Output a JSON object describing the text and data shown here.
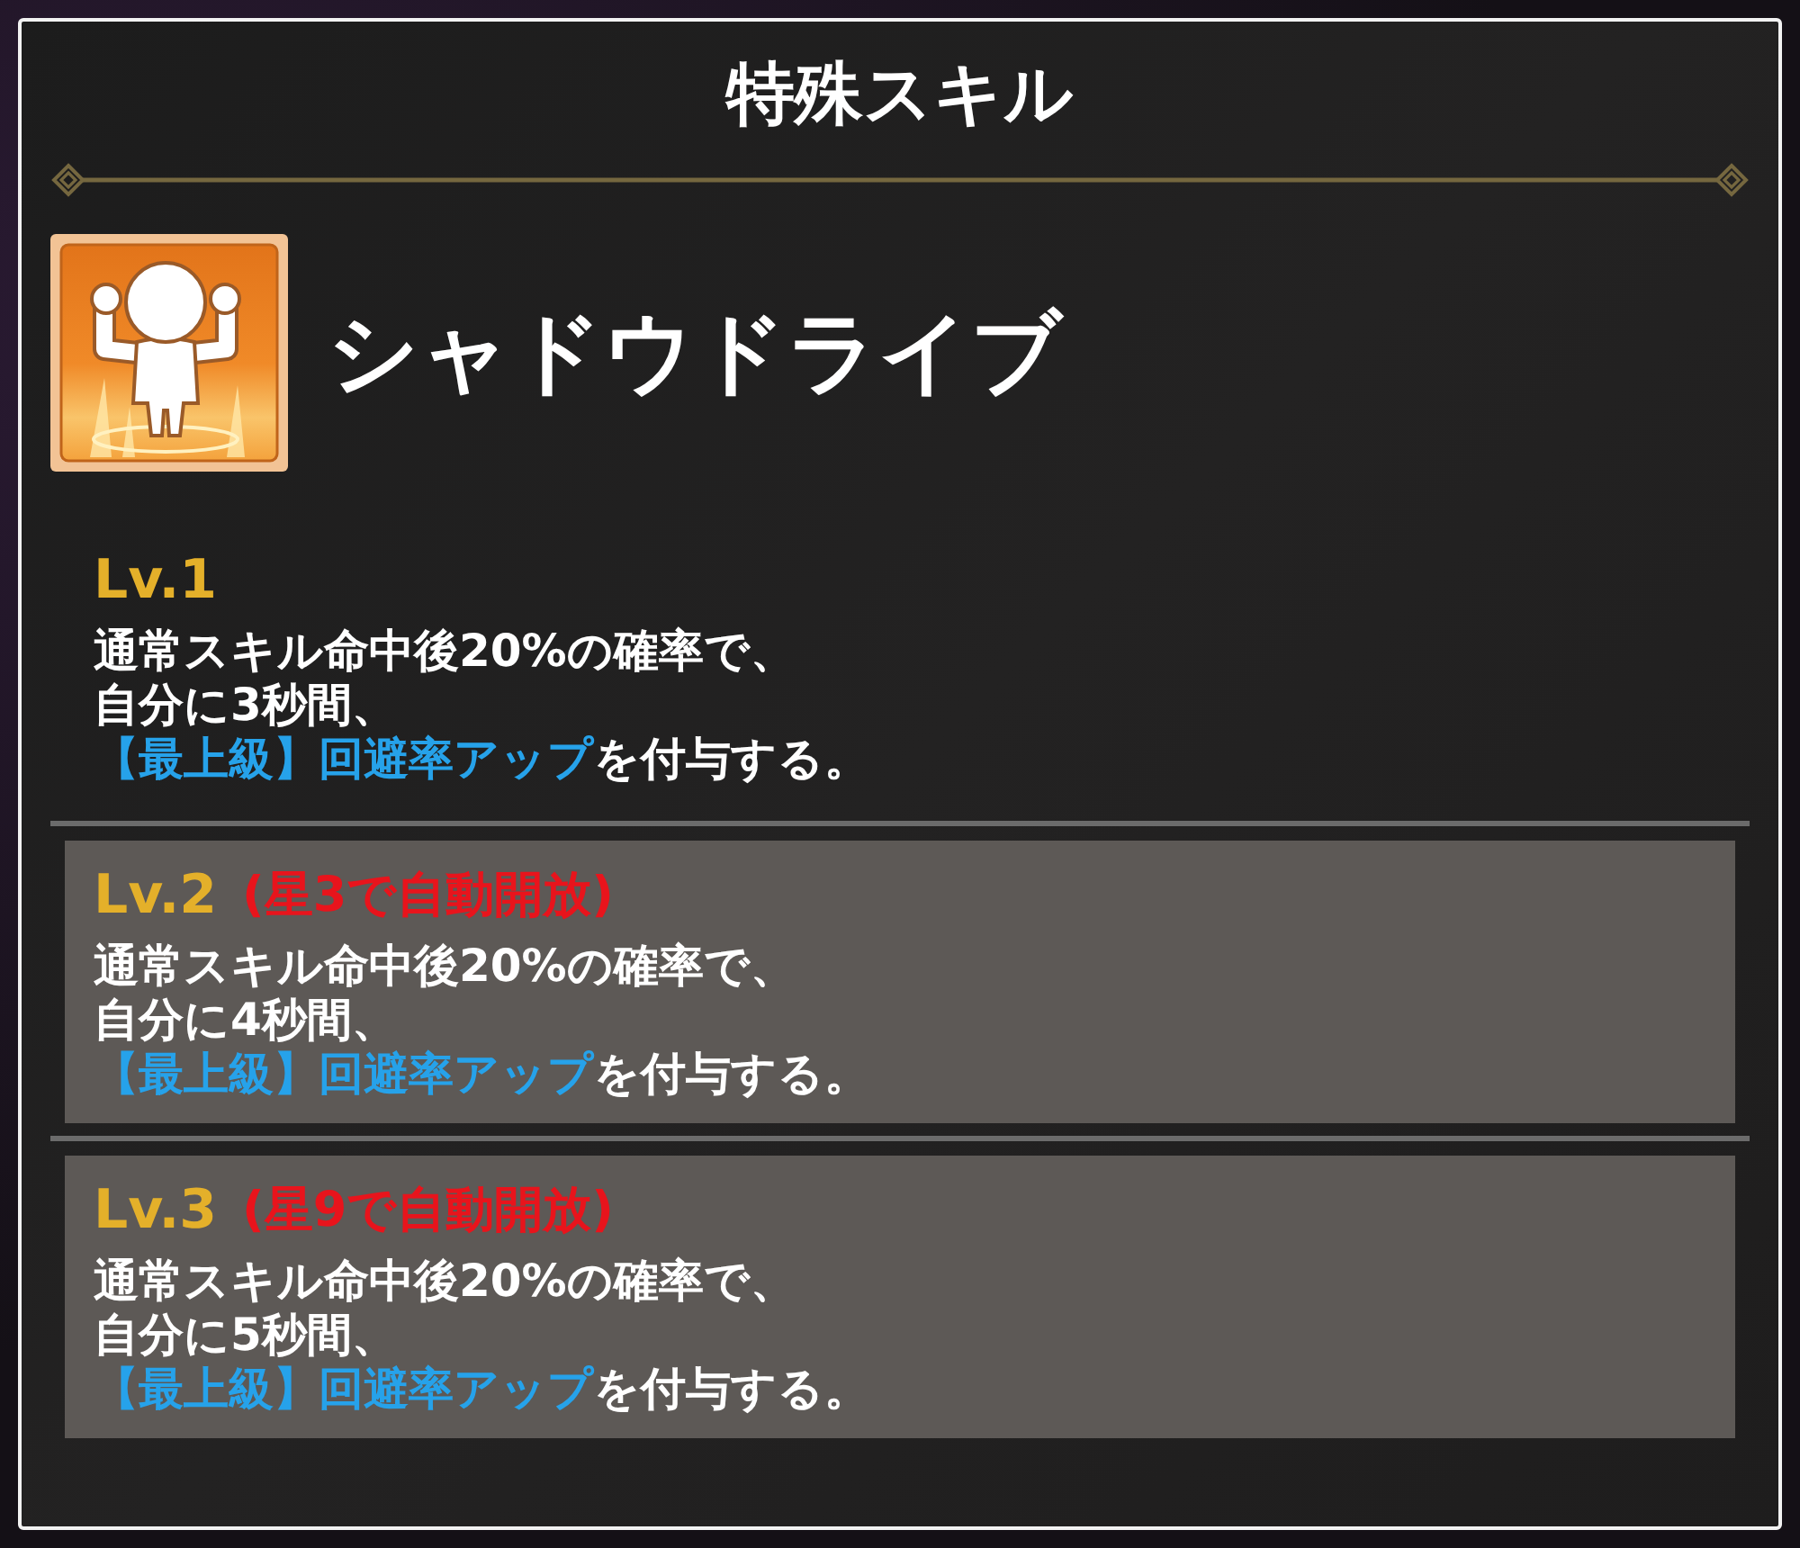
{
  "dialog": {
    "title": "特殊スキル"
  },
  "skill": {
    "name": "シャドウドライブ"
  },
  "levels": [
    {
      "label": "Lv.1",
      "locked": false,
      "description": [
        [
          {
            "text": "通常スキル命中後20%の確率で、",
            "highlight": false
          }
        ],
        [
          {
            "text": "自分に3秒間、",
            "highlight": false
          }
        ],
        [
          {
            "text": "【最上級】回避率アップ",
            "highlight": true
          },
          {
            "text": "を付与する。",
            "highlight": false
          }
        ]
      ]
    },
    {
      "label": "Lv.2",
      "locked": true,
      "unlock_note": "(星3で自動開放)",
      "description": [
        [
          {
            "text": "通常スキル命中後20%の確率で、",
            "highlight": false
          }
        ],
        [
          {
            "text": "自分に4秒間、",
            "highlight": false
          }
        ],
        [
          {
            "text": "【最上級】回避率アップ",
            "highlight": true
          },
          {
            "text": "を付与する。",
            "highlight": false
          }
        ]
      ]
    },
    {
      "label": "Lv.3",
      "locked": true,
      "unlock_note": "(星9で自動開放)",
      "description": [
        [
          {
            "text": "通常スキル命中後20%の確率で、",
            "highlight": false
          }
        ],
        [
          {
            "text": "自分に5秒間、",
            "highlight": false
          }
        ],
        [
          {
            "text": "【最上級】回避率アップ",
            "highlight": true
          },
          {
            "text": "を付与する。",
            "highlight": false
          }
        ]
      ]
    }
  ]
}
